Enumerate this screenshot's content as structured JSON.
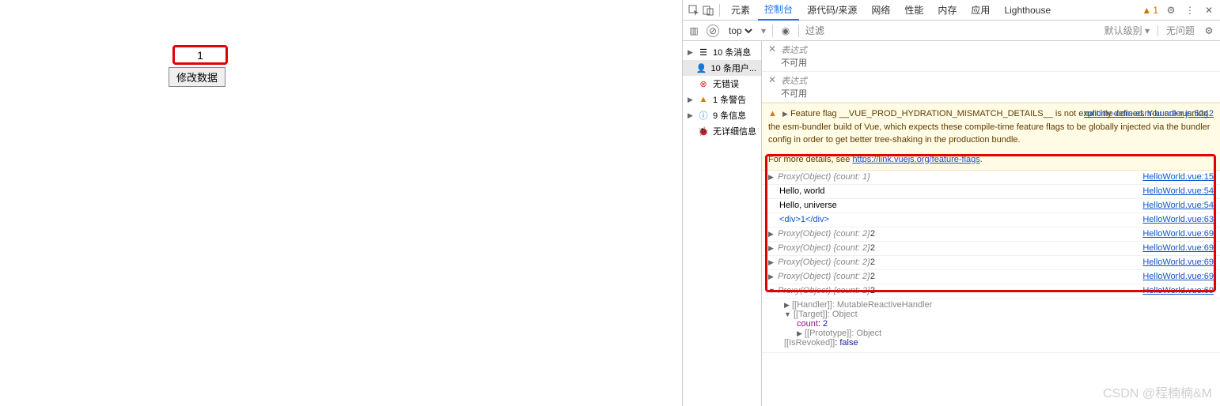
{
  "page": {
    "counter": "1",
    "button_label": "修改数据"
  },
  "devtools": {
    "tabs": [
      "元素",
      "控制台",
      "源代码/来源",
      "网络",
      "性能",
      "内存",
      "应用",
      "Lighthouse"
    ],
    "active_tab_index": 1,
    "warn_count": "1",
    "toolbar": {
      "context": "top",
      "filter_placeholder": "过滤",
      "level": "默认级别",
      "no_issues": "无问题"
    },
    "sidebar": [
      {
        "icon": "list",
        "label": "10 条消息",
        "expandable": true
      },
      {
        "icon": "user",
        "label": "10 条用户...",
        "selected": true
      },
      {
        "icon": "error",
        "label": "无错误",
        "cls": "red"
      },
      {
        "icon": "warn",
        "label": "1 条警告",
        "cls": "yellow",
        "expandable": true
      },
      {
        "icon": "info",
        "label": "9 条信息",
        "cls": "blue",
        "expandable": true
      },
      {
        "icon": "bug",
        "label": "无详细信息"
      }
    ],
    "expressions": {
      "label": "表达式",
      "na": "不可用"
    },
    "warning": {
      "text1": "Feature flag __VUE_PROD_HYDRATION_MISMATCH_DETAILS__ is not explicitly defined. You are running the esm-bundler build of Vue, which expects these compile-time feature flags to be globally injected via the bundler config in order to get better tree-shaking in the production bundle.",
      "text2_pre": "For more details, see ",
      "text2_link": "https://link.vuejs.org/feature-flags",
      "src": "runtime-core.esm-bundler.js:5242"
    },
    "logs": [
      {
        "prefix": "▶",
        "proxy": "Proxy(Object)",
        "obj": "{count: 1}",
        "src": "HelloWorld.vue:15"
      },
      {
        "text": "Hello, world",
        "src": "HelloWorld.vue:54"
      },
      {
        "text": "Hello, universe",
        "src": "HelloWorld.vue:54"
      },
      {
        "html_tag": "<div>1</div>",
        "src": "HelloWorld.vue:63",
        "blue": true
      },
      {
        "prefix": "▶",
        "proxy": "Proxy(Object)",
        "obj": "{count: 2}",
        "extra": "2",
        "src": "HelloWorld.vue:69"
      },
      {
        "prefix": "▶",
        "proxy": "Proxy(Object)",
        "obj": "{count: 2}",
        "extra": "2",
        "src": "HelloWorld.vue:69"
      },
      {
        "prefix": "▶",
        "proxy": "Proxy(Object)",
        "obj": "{count: 2}",
        "extra": "2",
        "src": "HelloWorld.vue:69"
      },
      {
        "prefix": "▶",
        "proxy": "Proxy(Object)",
        "obj": "{count: 2}",
        "extra": "2",
        "src": "HelloWorld.vue:69"
      },
      {
        "prefix": "▼",
        "proxy": "Proxy(Object)",
        "obj": "{count: 2}",
        "extra": "2",
        "src": "HelloWorld.vue:69",
        "expanded": true
      }
    ],
    "expanded": {
      "handler": "[[Handler]]: MutableReactiveHandler",
      "target": "[[Target]]: Object",
      "count_key": "count",
      "count_val": "2",
      "proto": "[[Prototype]]: Object",
      "revoked_key": "[[IsRevoked]]",
      "revoked_val": "false"
    }
  },
  "watermark": "CSDN @程楠楠&M"
}
